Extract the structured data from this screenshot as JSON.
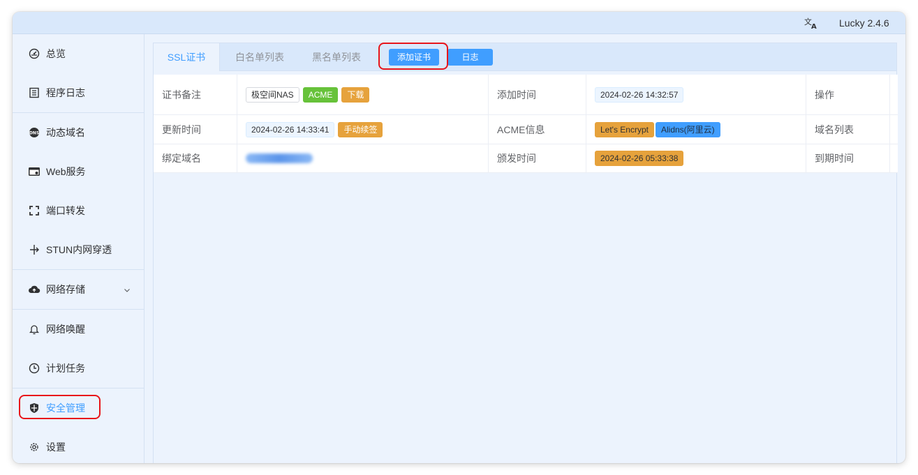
{
  "header": {
    "language_icon": "translate-icon",
    "app_version": "Lucky 2.4.6"
  },
  "sidebar": {
    "items": [
      {
        "label": "总览",
        "icon": "dashboard-icon"
      },
      {
        "label": "程序日志",
        "icon": "log-icon"
      },
      {
        "label": "动态域名",
        "icon": "ddns-icon"
      },
      {
        "label": "Web服务",
        "icon": "web-service-icon"
      },
      {
        "label": "端口转发",
        "icon": "port-forward-icon"
      },
      {
        "label": "STUN内网穿透",
        "icon": "stun-icon"
      },
      {
        "label": "网络存储",
        "icon": "cloud-upload-icon"
      },
      {
        "label": "网络唤醒",
        "icon": "bell-icon"
      },
      {
        "label": "计划任务",
        "icon": "clock-icon"
      },
      {
        "label": "安全管理",
        "icon": "shield-icon"
      },
      {
        "label": "设置",
        "icon": "gear-icon"
      }
    ],
    "active": "安全管理"
  },
  "tabs": {
    "ssl": "SSL证书",
    "whitelist": "白名单列表",
    "blacklist": "黑名单列表",
    "add_cert_button": "添加证书",
    "log_button": "日志"
  },
  "cert": {
    "remark_label": "证书备注",
    "remark_tag": "极空间NAS",
    "acme_tag": "ACME",
    "download_button": "下载",
    "add_time_label": "添加时间",
    "add_time": "2024-02-26 14:32:57",
    "operation_label": "操作",
    "update_time_label": "更新时间",
    "update_time": "2024-02-26 14:33:41",
    "manual_renew_button": "手动续签",
    "acme_info_label": "ACME信息",
    "acme_ca": "Let's Encrypt",
    "acme_dns": "Alidns(阿里云)",
    "domain_list_label": "域名列表",
    "bind_domain_label": "绑定域名",
    "issue_time_label": "颁发时间",
    "issue_time": "2024-02-26 05:33:38",
    "expire_time_label": "到期时间"
  },
  "colors": {
    "primary": "#409eff",
    "success": "#67c23a",
    "warning": "#e6a23c",
    "highlight": "#e8151a"
  }
}
